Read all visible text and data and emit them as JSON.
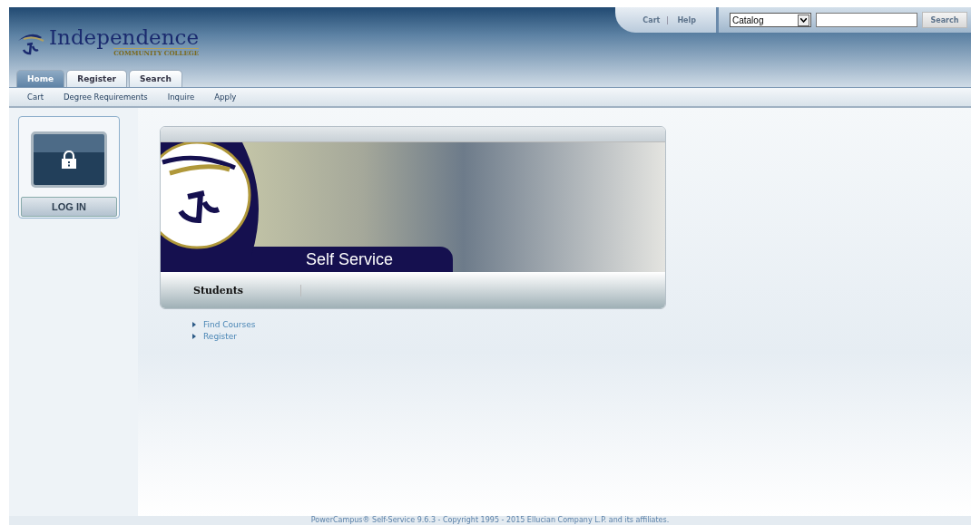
{
  "header": {
    "logo": {
      "name": "Independence",
      "subtitle": "COMMUNITY COLLEGE"
    },
    "utility_links": [
      "Cart",
      "Help"
    ],
    "search": {
      "scope": "Catalog",
      "button": "Search"
    }
  },
  "tabs": [
    {
      "label": "Home",
      "selected": true
    },
    {
      "label": "Register",
      "selected": false
    },
    {
      "label": "Search",
      "selected": false
    }
  ],
  "subnav": [
    "Cart",
    "Degree Requirements",
    "Inquire",
    "Apply"
  ],
  "sidebar": {
    "login": "LOG IN"
  },
  "banner": {
    "title": "Self Service",
    "section": "Students"
  },
  "links": [
    "Find Courses",
    "Register"
  ],
  "footer": "PowerCampus® Self-Service 9.6.3 - Copyright 1995 - 2015 Ellucian Company L.P. and its affiliates."
}
